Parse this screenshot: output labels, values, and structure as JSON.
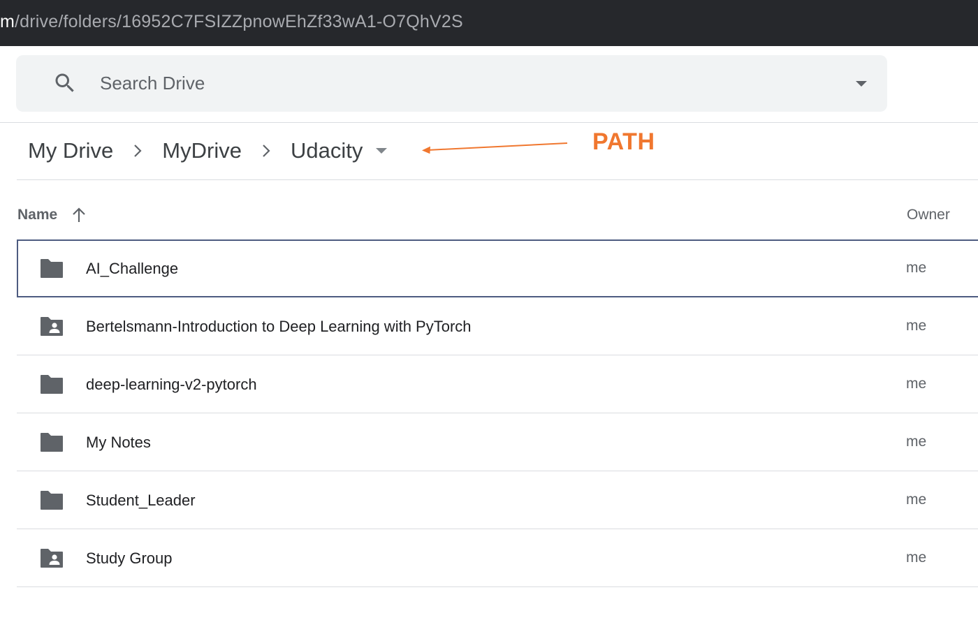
{
  "browser": {
    "url_host_part": "m",
    "url_path_part": "/drive/folders/16952C7FSIZZpnowEhZf33wA1-O7QhV2S"
  },
  "search": {
    "placeholder": "Search Drive",
    "icon": "search-icon",
    "dropdown_icon": "caret-down-icon"
  },
  "breadcrumb": {
    "items": [
      {
        "label": "My Drive"
      },
      {
        "label": "MyDrive"
      },
      {
        "label": "Udacity"
      }
    ],
    "separator_icon": "chevron-right-icon",
    "dropdown_icon": "caret-down-icon"
  },
  "annotation": {
    "label": "PATH",
    "color": "#f0772f"
  },
  "table": {
    "columns": {
      "name": "Name",
      "owner": "Owner",
      "sort_icon": "arrow-up-icon"
    },
    "rows": [
      {
        "name": "AI_Challenge",
        "owner": "me",
        "icon": "folder-icon",
        "selected": true
      },
      {
        "name": "Bertelsmann-Introduction to Deep Learning with PyTorch",
        "owner": "me",
        "icon": "shared-folder-icon",
        "selected": false
      },
      {
        "name": "deep-learning-v2-pytorch",
        "owner": "me",
        "icon": "folder-icon",
        "selected": false
      },
      {
        "name": "My Notes",
        "owner": "me",
        "icon": "folder-icon",
        "selected": false
      },
      {
        "name": "Student_Leader",
        "owner": "me",
        "icon": "folder-icon",
        "selected": false
      },
      {
        "name": "Study Group",
        "owner": "me",
        "icon": "shared-folder-icon",
        "selected": false
      }
    ]
  },
  "colors": {
    "url_bar_bg": "#26282c",
    "search_bg": "#f1f3f4",
    "selection_border": "#4d5b80",
    "icon_gray": "#5f6368"
  }
}
